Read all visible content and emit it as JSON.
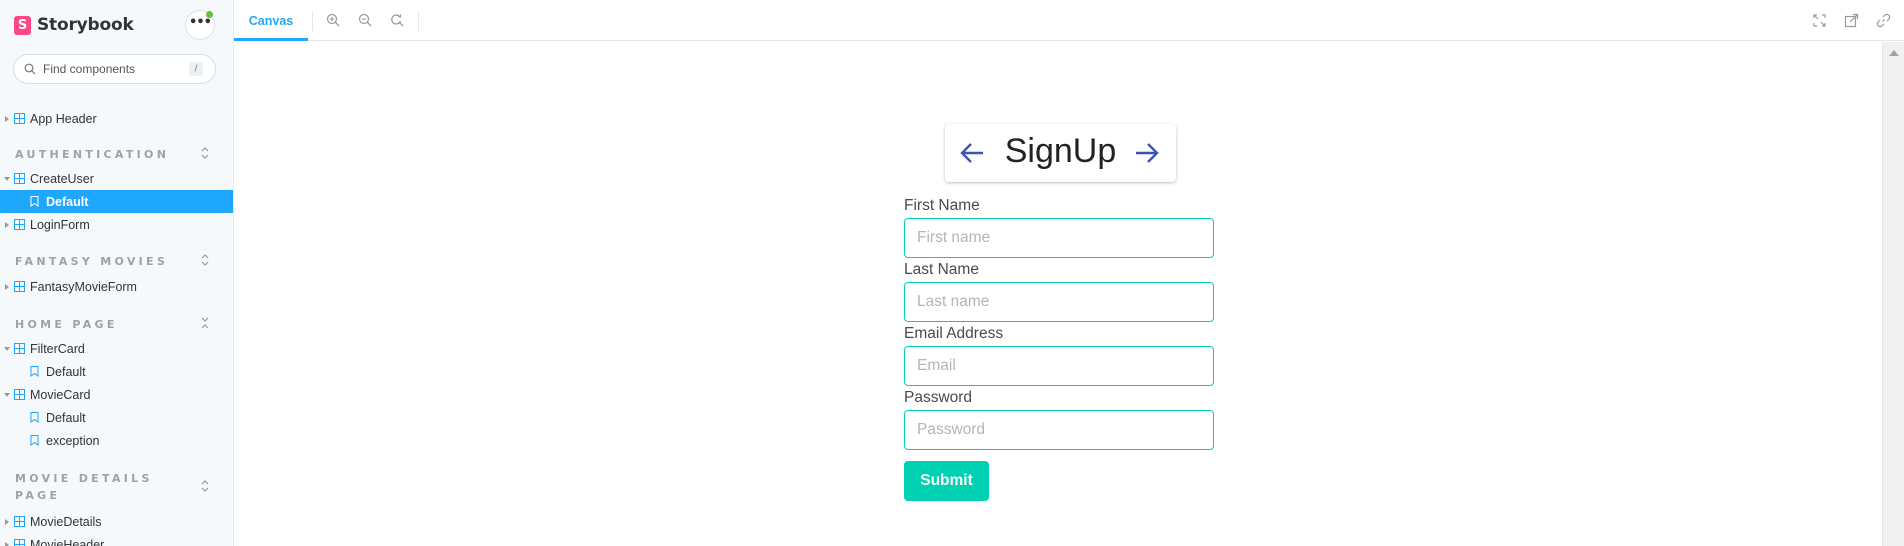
{
  "brand": {
    "name": "Storybook",
    "logo_letter": "S"
  },
  "search": {
    "placeholder": "Find components",
    "shortcut": "/"
  },
  "sidebar": {
    "items": [
      {
        "type": "component",
        "label": "App Header"
      },
      {
        "type": "group",
        "label": "AUTHENTICATION"
      },
      {
        "type": "component",
        "label": "CreateUser"
      },
      {
        "type": "story",
        "label": "Default",
        "selected": true
      },
      {
        "type": "component",
        "label": "LoginForm"
      },
      {
        "type": "group",
        "label": "FANTASY MOVIES"
      },
      {
        "type": "component",
        "label": "FantasyMovieForm"
      },
      {
        "type": "group",
        "label": "HOME PAGE"
      },
      {
        "type": "component",
        "label": "FilterCard"
      },
      {
        "type": "story",
        "label": "Default"
      },
      {
        "type": "component",
        "label": "MovieCard"
      },
      {
        "type": "story",
        "label": "Default"
      },
      {
        "type": "story",
        "label": "exception"
      },
      {
        "type": "group",
        "label": "MOVIE DETAILS PAGE"
      },
      {
        "type": "component",
        "label": "MovieDetails"
      },
      {
        "type": "component",
        "label": "MovieHeader"
      }
    ]
  },
  "toolbar": {
    "tab_canvas": "Canvas",
    "icons": [
      "zoom-in-icon",
      "zoom-out-icon",
      "zoom-reset-icon",
      "fullscreen-icon",
      "open-new-tab-icon",
      "copy-link-icon"
    ]
  },
  "form": {
    "title": "SignUp",
    "fields": [
      {
        "label": "First Name",
        "placeholder": "First name"
      },
      {
        "label": "Last Name",
        "placeholder": "Last name"
      },
      {
        "label": "Email Address",
        "placeholder": "Email"
      },
      {
        "label": "Password",
        "placeholder": "Password"
      }
    ],
    "submit_label": "Submit"
  },
  "colors": {
    "accent": "#1ea7fd",
    "brand": "#ff4785",
    "form_primary": "#00d1b2",
    "arrow": "#3f51b5"
  }
}
